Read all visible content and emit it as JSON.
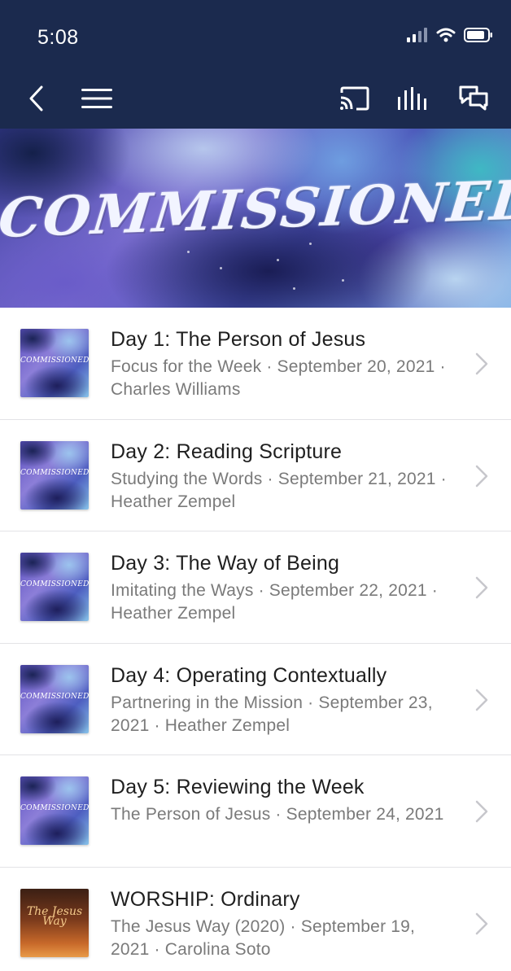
{
  "status_bar": {
    "time": "5:08"
  },
  "banner": {
    "title": "COMMISSIONED"
  },
  "items": [
    {
      "title": "Day 1: The Person of Jesus",
      "subtitle": "Focus for the Week · September 20, 2021 · Charles Williams",
      "thumb": "COMMISSIONED"
    },
    {
      "title": "Day 2: Reading Scripture",
      "subtitle": "Studying the Words · September 21, 2021 · Heather Zempel",
      "thumb": "COMMISSIONED"
    },
    {
      "title": "Day 3: The Way of Being",
      "subtitle": "Imitating the Ways · September 22, 2021 · Heather Zempel",
      "thumb": "COMMISSIONED"
    },
    {
      "title": "Day 4: Operating Contextually",
      "subtitle": "Partnering in the Mission · September 23, 2021 · Heather Zempel",
      "thumb": "COMMISSIONED"
    },
    {
      "title": "Day 5: Reviewing the Week",
      "subtitle": "The Person of Jesus · September 24, 2021",
      "thumb": "COMMISSIONED"
    },
    {
      "title": "WORSHIP: Ordinary",
      "subtitle": "The Jesus Way (2020) · September 19, 2021 · Carolina Soto",
      "thumb": "The Jesus Way"
    }
  ],
  "colors": {
    "nav_bg": "#1b2a4e",
    "title_text": "#1f1f1f",
    "subtitle_text": "#7a7a7a",
    "divider": "#e3e3e6"
  },
  "icons": [
    "signal-icon",
    "wifi-icon",
    "battery-icon",
    "back-icon",
    "menu-icon",
    "cast-icon",
    "audio-bars-icon",
    "chat-icon",
    "chevron-right-icon"
  ]
}
